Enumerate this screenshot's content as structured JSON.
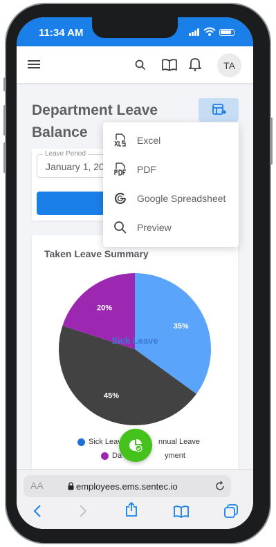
{
  "status_bar": {
    "time": "11:34 AM"
  },
  "app_bar": {
    "avatar_initials": "TA"
  },
  "page": {
    "title": "Department Leave Balance"
  },
  "filter": {
    "leave_period_label": "Leave Period",
    "leave_period_value": "January 1, 20"
  },
  "export_menu": {
    "items": [
      {
        "label": "Excel",
        "icon": "xls-file-icon"
      },
      {
        "label": "PDF",
        "icon": "pdf-file-icon"
      },
      {
        "label": "Google Spreadsheet",
        "icon": "google-icon"
      },
      {
        "label": "Preview",
        "icon": "search-icon"
      }
    ]
  },
  "chart_card": {
    "title": "Taken Leave Summary"
  },
  "chart_data": {
    "type": "pie",
    "title": "Taken Leave Summary",
    "slices": [
      {
        "name": "Sick Leave",
        "value": 35,
        "label": "35%",
        "color": "#5ba4fc"
      },
      {
        "name": "Annual Leave",
        "value": 45,
        "label": "45%",
        "color": "#424242"
      },
      {
        "name": "Day Employment",
        "value": 20,
        "label": "20%",
        "color": "#9c27b0"
      }
    ],
    "hover_label": "Sick Leave",
    "legend_placement": "bottom",
    "legend": [
      {
        "text": "Sick Leav",
        "color": "#1f6fd6"
      },
      {
        "text": "nnual Leave",
        "color": "#1f6fd6"
      },
      {
        "text": "Da",
        "color": "#9c27b0"
      },
      {
        "text": "yment",
        "color": "#9c27b0"
      }
    ]
  },
  "browser": {
    "aa_label": "AA",
    "url": "employees.ems.sentec.io"
  },
  "colors": {
    "primary": "#1a7fe8",
    "fab": "#46c21c",
    "export_button_bg": "#c7ddf5"
  }
}
